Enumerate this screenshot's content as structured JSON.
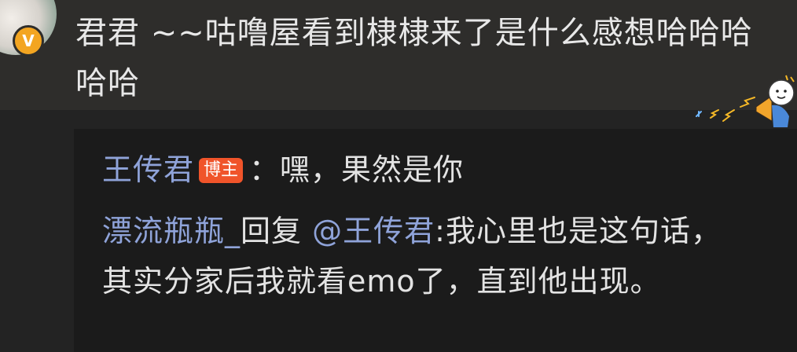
{
  "comment": {
    "verified_badge": "V",
    "text": "君君 ~~咕噜屋看到棣棣来了是什么感想哈哈哈哈哈",
    "sticker_icon": "megaphone-cartoon-sticker"
  },
  "replies": [
    {
      "author": "王传君",
      "badge": "博主",
      "separator": "：",
      "text": "嘿，果然是你"
    },
    {
      "author": "漂流瓶瓶_",
      "reply_word": "回复",
      "mention": "@王传君",
      "separator": ":",
      "text": "我心里也是这句话，其实分家后我就看emo了，直到他出现。"
    }
  ],
  "colors": {
    "username": "#8fa3d9",
    "badge": "#f0542a",
    "verified": "#f3a521"
  }
}
